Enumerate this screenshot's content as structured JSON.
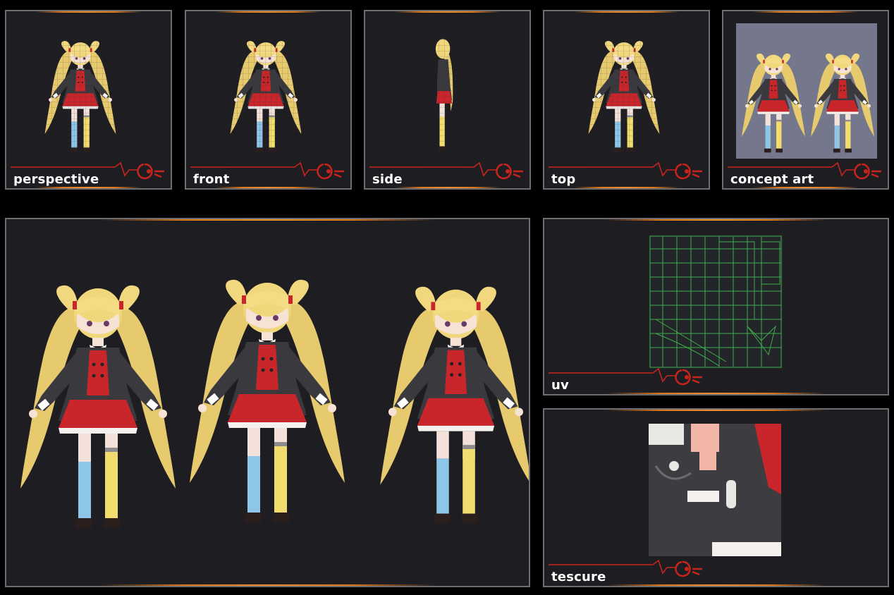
{
  "views": {
    "perspective": "perspective",
    "front": "front",
    "side": "side",
    "top": "top",
    "concept": "concept art",
    "uv": "uv",
    "texture": "tescure"
  },
  "colors": {
    "panel_bg": "#1e1e22",
    "border": "#6e6e72",
    "accent_orange": "#e0781a",
    "deco_red": "#c8241c",
    "hair": "#ecd27a",
    "coat": "#3a3a3e",
    "skirt": "#c9262b",
    "sock_blue": "#8ec6e8",
    "sock_yellow": "#f2dc6e",
    "uv_green": "#3fae4a",
    "concept_bg": "#75788c"
  },
  "icons": {
    "corner_logo": "gear-emblem"
  }
}
